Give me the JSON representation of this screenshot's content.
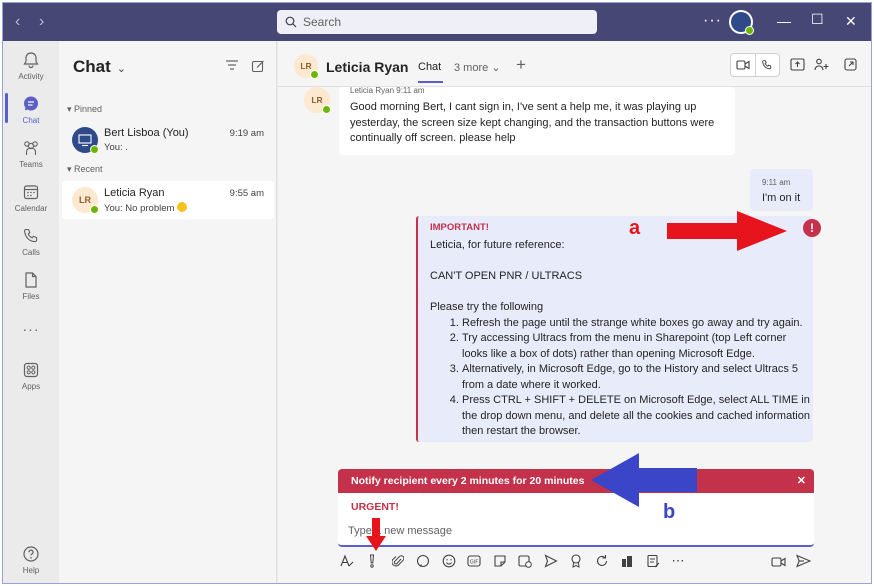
{
  "titlebar": {
    "search_placeholder": "Search",
    "more_label": "···"
  },
  "rail": {
    "items": [
      {
        "label": "Activity",
        "icon": "bell-icon"
      },
      {
        "label": "Chat",
        "icon": "chat-icon"
      },
      {
        "label": "Teams",
        "icon": "teams-icon"
      },
      {
        "label": "Calendar",
        "icon": "calendar-icon"
      },
      {
        "label": "Calls",
        "icon": "phone-icon"
      },
      {
        "label": "Files",
        "icon": "file-icon"
      },
      {
        "label": "···",
        "icon": "more-icon"
      },
      {
        "label": "Apps",
        "icon": "apps-icon"
      },
      {
        "label": "Help",
        "icon": "help-icon"
      }
    ],
    "active": "Chat"
  },
  "chatlist": {
    "title": "Chat",
    "sections": {
      "pinned": "Pinned",
      "recent": "Recent"
    },
    "chats": [
      {
        "name": "Bert Lisboa (You)",
        "preview": "You: .",
        "time": "9:19 am",
        "initials": ""
      },
      {
        "name": "Leticia Ryan",
        "preview": "You: No problem",
        "time": "9:55 am",
        "initials": "LR"
      }
    ]
  },
  "header": {
    "initials": "LR",
    "name": "Leticia Ryan",
    "tab": "Chat",
    "more_tabs": "3 more",
    "more_chevron": "⌄",
    "add": "+"
  },
  "messages": {
    "incoming": {
      "initials": "LR",
      "sender_time": "Leticia Ryan    9:11 am",
      "text": "Good morning Bert, I cant sign in, I've sent a help me, it was playing up yesterday, the screen size kept changing, and the transaction buttons were continually off screen. please help"
    },
    "outgoing": {
      "time": "9:11 am",
      "text": "I'm on it"
    },
    "important": {
      "label": "IMPORTANT!",
      "greeting": "Leticia, for future reference:",
      "heading": "CAN'T OPEN PNR / ULTRACS",
      "intro": "Please try the following",
      "steps": [
        "Refresh the page until the strange white boxes go away and try again.",
        "Try accessing Ultracs from the menu in Sharepoint (top Left corner looks like a box of dots) rather than opening Microsoft Edge.",
        "Alternatively, in Microsoft Edge, go to the History and select Ultracs 5 from a date where it worked.",
        "Press CTRL + SHIFT + DELETE on Microsoft Edge, select ALL TIME in the drop down menu, and delete all the cookies and cached information then restart the browser."
      ],
      "alert_glyph": "!"
    }
  },
  "compose": {
    "notify_text": "Notify recipient every 2 minutes for 20 minutes",
    "close_glyph": "✕",
    "urgent_label": "URGENT!",
    "placeholder": "Type a new message"
  },
  "annotations": {
    "a": "a",
    "b": "b",
    "color": "#e8141d",
    "blue": "#3b45c8"
  },
  "colors": {
    "titlebar": "#464775",
    "accent": "#5b5fc7",
    "urgent": "#c4314b",
    "presence": "#6bb700"
  }
}
